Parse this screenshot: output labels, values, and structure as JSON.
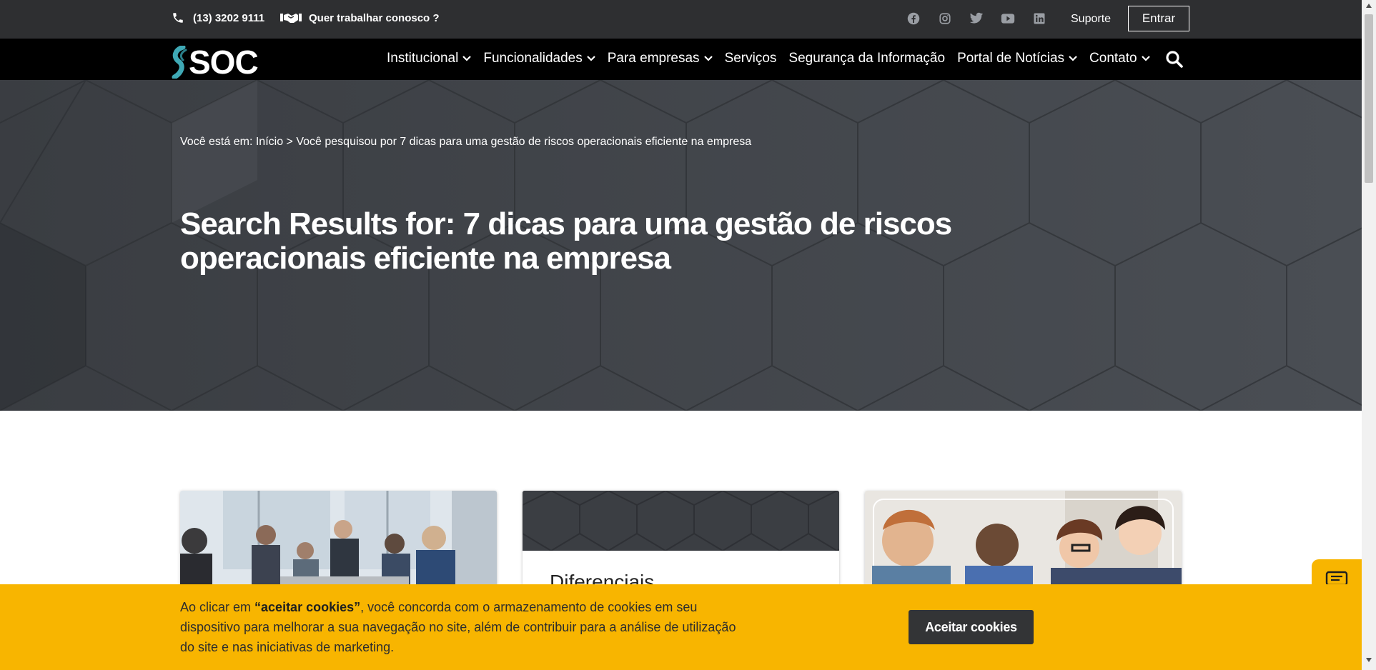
{
  "topbar": {
    "phone": "(13) 3202 9111",
    "work": "Quer trabalhar conosco ?",
    "social": [
      "facebook-icon",
      "instagram-icon",
      "twitter-icon",
      "youtube-icon",
      "linkedin-icon"
    ],
    "support": "Suporte",
    "login": "Entrar"
  },
  "nav": {
    "logo": "SOC",
    "items": [
      {
        "label": "Institucional",
        "dropdown": true
      },
      {
        "label": "Funcionalidades",
        "dropdown": true
      },
      {
        "label": "Para empresas",
        "dropdown": true
      },
      {
        "label": "Serviços",
        "dropdown": false
      },
      {
        "label": "Segurança da Informação",
        "dropdown": false
      },
      {
        "label": "Portal de Notícias",
        "dropdown": true
      },
      {
        "label": "Contato",
        "dropdown": true
      }
    ]
  },
  "hero": {
    "breadcrumb_prefix": "Você está em:",
    "breadcrumb_home": "Início",
    "breadcrumb_sep": ">",
    "breadcrumb_current": "Você pesquisou por 7 dicas para uma gestão de riscos operacionais eficiente na empresa",
    "title": "Search Results for: 7 dicas para uma gestão de riscos operacionais eficiente na empresa"
  },
  "cards": [
    {
      "title": ""
    },
    {
      "title": "Diferenciais"
    },
    {
      "title": ""
    }
  ],
  "cookie": {
    "text_before": "Ao clicar em ",
    "text_bold": "“aceitar cookies”",
    "text_after": ", você concorda com o armazenamento de cookies em seu dispositivo para melhorar a sua navegação no site, além de contribuir para a análise de utilização do site e nas iniciativas de marketing.",
    "button": "Aceitar cookies"
  },
  "colors": {
    "topbar": "#2e2f31",
    "nav": "#000000",
    "hero": "#3f4348",
    "cookie": "#f8b500",
    "button_dark": "#333436",
    "logo_teal": "#3fa9b5"
  }
}
